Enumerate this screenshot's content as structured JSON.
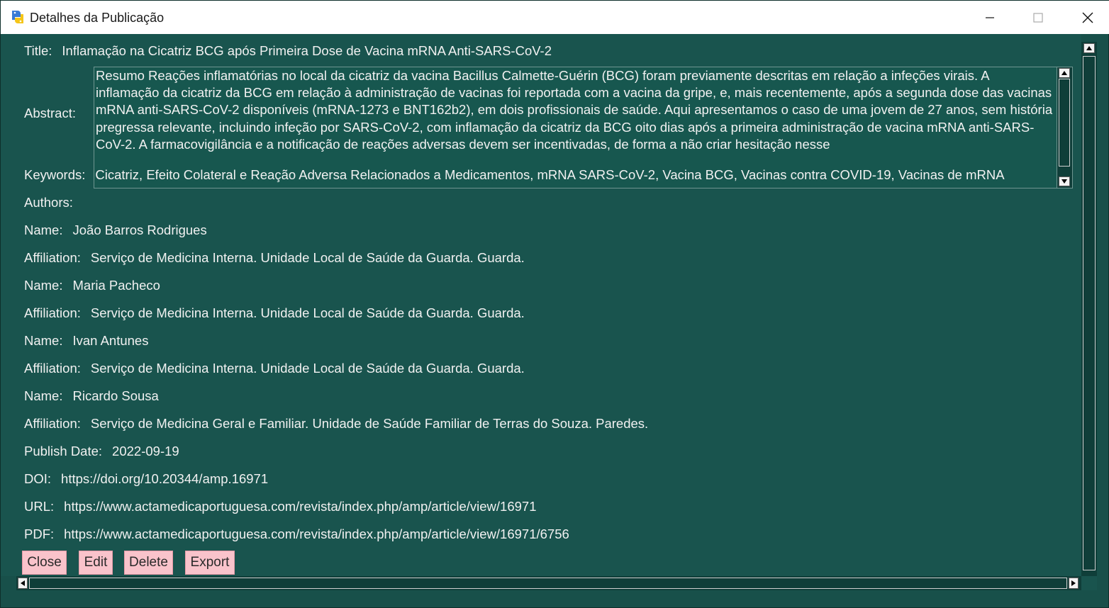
{
  "window": {
    "title": "Detalhes da Publicação",
    "minimize": "minimize",
    "maximize": "maximize",
    "close": "close"
  },
  "publication": {
    "title_label": "Title:",
    "title": "Inflamação na Cicatriz BCG após Primeira Dose de Vacina mRNA Anti-SARS-CoV-2",
    "abstract_label": "Abstract:",
    "abstract": "Resumo Reações inflamatórias no local da cicatriz da vacina Bacillus Calmette-Guérin (BCG) foram previamente descritas em relação a infeções virais. A inflamação da cicatriz da BCG em relação à administração de vacinas foi reportada com a vacina da gripe, e, mais recentemente, após a segunda dose das vacinas mRNA anti-SARS-CoV-2 disponíveis (mRNA-1273 e BNT162b2), em dois profissionais de saúde. Aqui apresentamos o caso de uma jovem de 27 anos, sem história pregressa relevante, incluindo infeção por SARS-CoV-2, com inflamação da cicatriz da BCG oito dias após a primeira administração de vacina mRNA anti-SARS-CoV-2. A farmacovigilância e a notificação de reações adversas devem ser incentivadas, de forma a não criar hesitação nesse",
    "keywords_label": "Keywords:",
    "keywords": "Cicatriz, Efeito Colateral e Reação Adversa Relacionados a Medicamentos, mRNA SARS-CoV-2, Vacina BCG, Vacinas contra COVID-19, Vacinas de mRNA",
    "authors_label": "Authors:",
    "name_label": "Name:",
    "affiliation_label": "Affiliation:",
    "authors": [
      {
        "name": "João Barros Rodrigues",
        "affiliation": "Serviço de Medicina Interna. Unidade Local de Saúde da Guarda. Guarda."
      },
      {
        "name": "Maria Pacheco",
        "affiliation": "Serviço de Medicina Interna. Unidade Local de Saúde da Guarda. Guarda."
      },
      {
        "name": "Ivan Antunes",
        "affiliation": "Serviço de Medicina Interna. Unidade Local de Saúde da Guarda. Guarda."
      },
      {
        "name": "Ricardo Sousa",
        "affiliation": "Serviço de Medicina Geral e Familiar. Unidade de Saúde Familiar de Terras do Souza. Paredes."
      }
    ],
    "publish_date_label": "Publish Date:",
    "publish_date": "2022-09-19",
    "doi_label": "DOI:",
    "doi": "https://doi.org/10.20344/amp.16971",
    "url_label": "URL:",
    "url": "https://www.actamedicaportuguesa.com/revista/index.php/amp/article/view/16971",
    "pdf_label": "PDF:",
    "pdf": "https://www.actamedicaportuguesa.com/revista/index.php/amp/article/view/16971/6756"
  },
  "buttons": {
    "close": "Close",
    "edit": "Edit",
    "delete": "Delete",
    "export": "Export"
  },
  "colors": {
    "background": "#19544e",
    "button": "#f9c3cb",
    "text": "#f1f1f1"
  }
}
